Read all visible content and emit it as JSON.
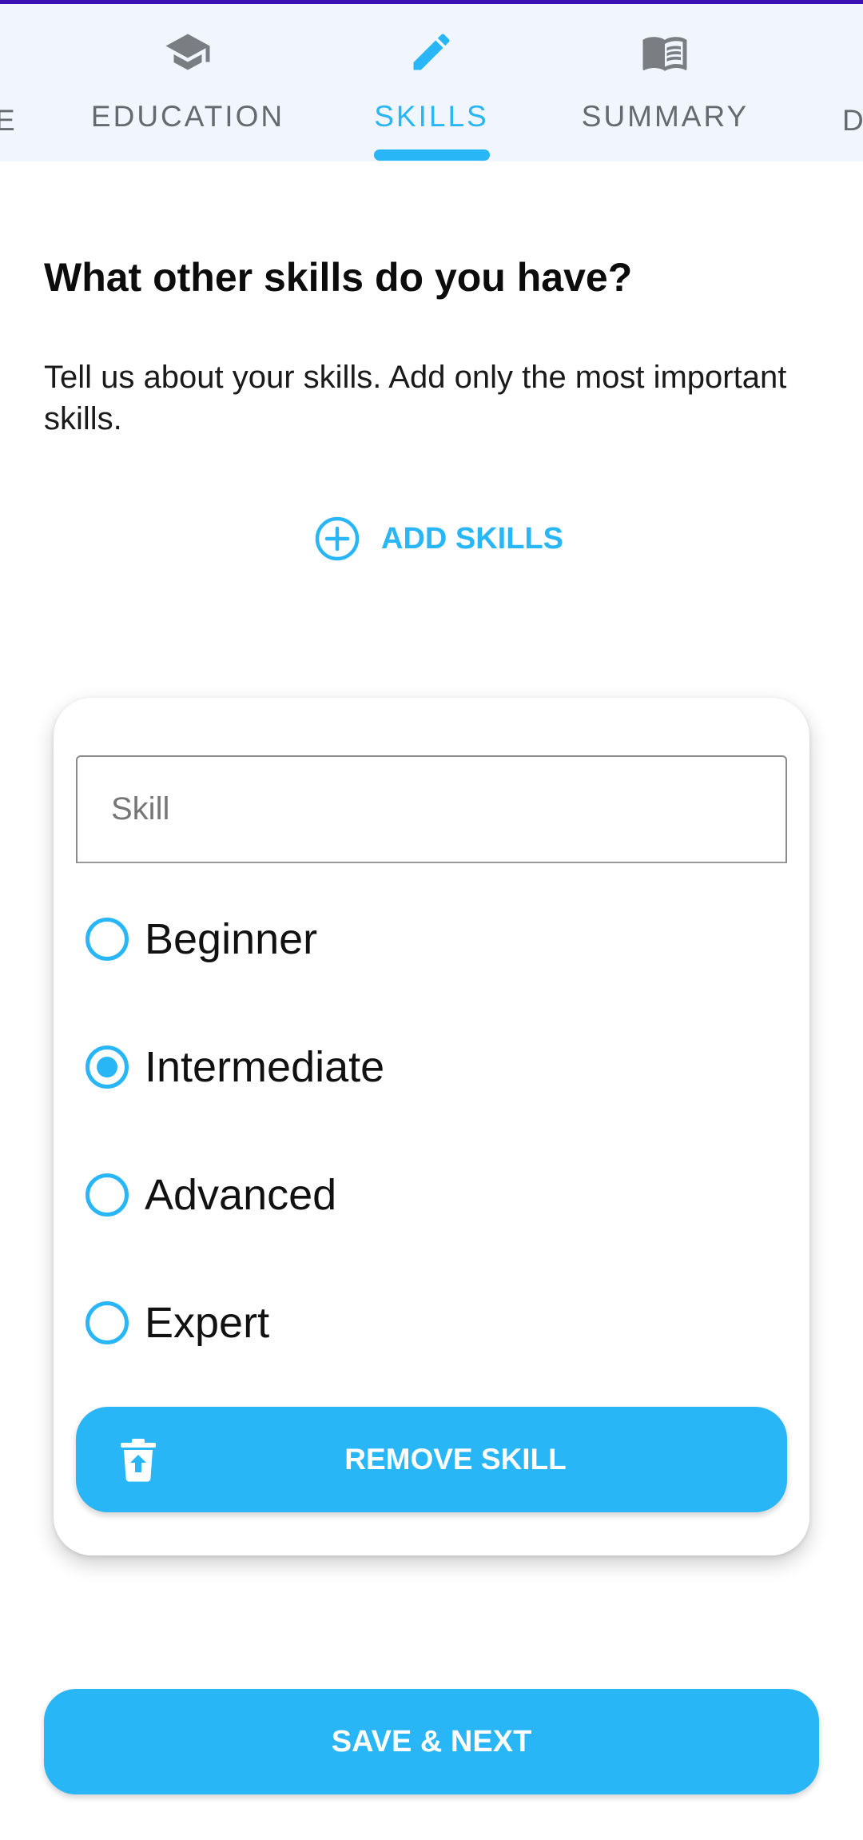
{
  "tabs": {
    "left_edge_label": "E",
    "right_edge_label": "D",
    "items": [
      {
        "label": "EDUCATION",
        "icon": "graduation-cap-icon",
        "active": false
      },
      {
        "label": "SKILLS",
        "icon": "pencil-icon",
        "active": true
      },
      {
        "label": "SUMMARY",
        "icon": "book-icon",
        "active": false
      }
    ]
  },
  "page": {
    "heading": "What other skills do you have?",
    "subtext": "Tell us about your skills. Add only the most important skills.",
    "add_skills_label": "ADD SKILLS",
    "add_icon": "add-circle-icon"
  },
  "skill_card": {
    "skill_placeholder": "Skill",
    "skill_value": "",
    "levels": [
      {
        "label": "Beginner",
        "checked": false
      },
      {
        "label": "Intermediate",
        "checked": true
      },
      {
        "label": "Advanced",
        "checked": false
      },
      {
        "label": "Expert",
        "checked": false
      }
    ],
    "remove_label": "REMOVE SKILL",
    "remove_icon": "trash-icon"
  },
  "footer": {
    "save_label": "SAVE & NEXT"
  },
  "colors": {
    "accent": "#29b6f6",
    "tabbar_bg": "#f1f6fe",
    "inactive_tab": "#666a70",
    "status_line": "#3a11b4"
  }
}
